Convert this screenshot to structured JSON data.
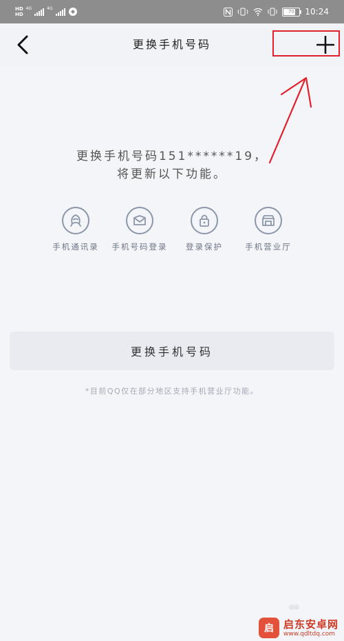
{
  "status_bar": {
    "left_hd_top": "HD",
    "left_hd_bottom": "HD",
    "network_1": "4G",
    "network_2": "4G",
    "battery": "70",
    "time": "10:24"
  },
  "navbar": {
    "title": "更换手机号码"
  },
  "main": {
    "description_line1": "更换手机号码151******19，",
    "description_line2": "将更新以下功能。",
    "features": [
      {
        "label": "手机通讯录",
        "icon": "contacts-icon"
      },
      {
        "label": "手机号码登录",
        "icon": "mail-icon"
      },
      {
        "label": "登录保护",
        "icon": "lock-icon"
      },
      {
        "label": "手机营业厅",
        "icon": "store-icon"
      }
    ],
    "change_button": "更换手机号码",
    "note": "*目前QQ仅在部分地区支持手机营业厅功能。"
  },
  "watermark": {
    "logo_text": "启",
    "name": "启东安卓网",
    "url": "www.qdltdq.com"
  },
  "colors": {
    "highlight": "#e0202a",
    "icon_stroke": "#8b96a8",
    "background": "#f4f5f9"
  }
}
